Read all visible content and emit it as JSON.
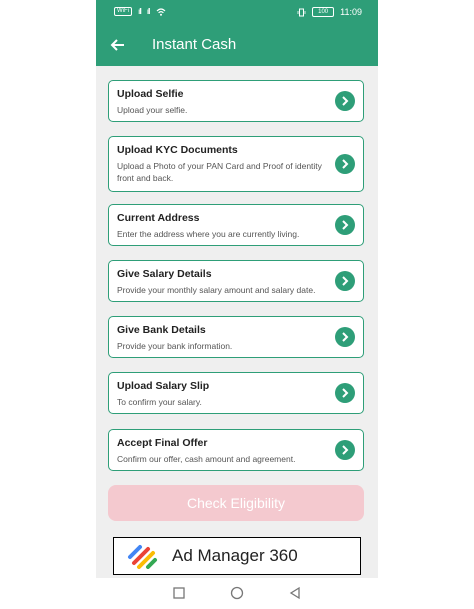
{
  "status_bar": {
    "left_badge": "WiFi",
    "signal_1": "ıll",
    "signal_2": "ıll",
    "battery": "100",
    "time": "11:09"
  },
  "app_bar": {
    "title": "Instant Cash",
    "back_icon": "arrow-left-icon"
  },
  "steps": [
    {
      "title": "Upload Selfie",
      "description": "Upload your selfie."
    },
    {
      "title": "Upload KYC Documents",
      "description": "Upload a Photo of your PAN Card and Proof of identity front and back."
    },
    {
      "title": "Current Address",
      "description": "Enter the address where you are currently living."
    },
    {
      "title": "Give Salary Details",
      "description": "Provide your monthly salary amount and salary date."
    },
    {
      "title": "Give Bank Details",
      "description": "Provide your bank information."
    },
    {
      "title": "Upload Salary Slip",
      "description": "To confirm your salary."
    },
    {
      "title": "Accept Final Offer",
      "description": "Confirm our offer, cash amount and agreement."
    }
  ],
  "check_button": {
    "label": "Check Eligibility"
  },
  "ad": {
    "text": "Ad Manager 360"
  },
  "colors": {
    "primary": "#2e9e78",
    "disabled_button": "#f4c9cf",
    "background": "#efefef"
  },
  "nav": {
    "square_icon": "recent-apps-icon",
    "circle_icon": "home-icon",
    "triangle_icon": "back-icon"
  }
}
